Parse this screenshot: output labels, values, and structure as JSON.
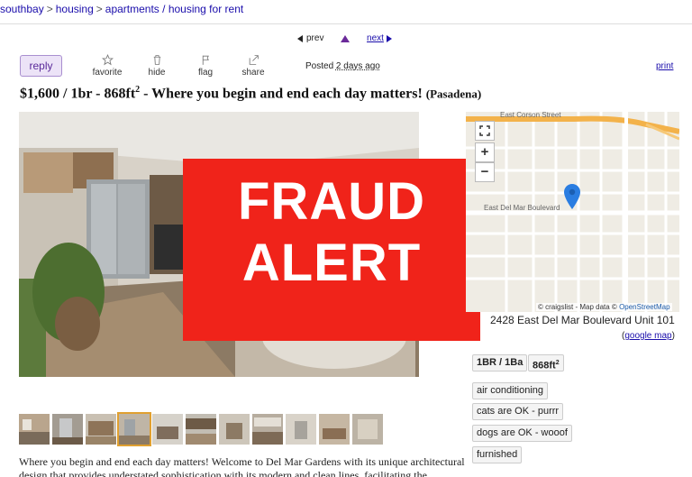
{
  "breadcrumb": {
    "items": [
      "southbay",
      "housing",
      "apartments / housing for rent"
    ],
    "sep": ">"
  },
  "pager": {
    "prev": "prev",
    "next": "next"
  },
  "actions": {
    "reply": "reply",
    "favorite": "favorite",
    "hide": "hide",
    "flag": "flag",
    "share": "share"
  },
  "posted": {
    "prefix": "Posted",
    "when": "2 days ago"
  },
  "print": "print",
  "title": {
    "main": "$1,600 / 1br - 868ft",
    "sup": "2",
    "tail": " - Where you begin and end each day matters!",
    "location": "(Pasadena)"
  },
  "overlay": {
    "line1": "FRAUD",
    "line2": "ALERT"
  },
  "description": "Where you begin and end each day matters! Welcome to Del Mar Gardens with its unique architectural design that provides understated sophistication with its modern and clean lines, facilitating the",
  "map": {
    "street_top": "East Corson Street",
    "street_mid": "East Del Mar Boulevard",
    "zoom_in": "+",
    "zoom_out": "−",
    "attribution": "© craigslist - Map data ©",
    "osm": "OpenStreetMap"
  },
  "address": "2428 East Del Mar Boulevard Unit 101",
  "google_map": {
    "open": "(",
    "link": "google map",
    "close": ")"
  },
  "attrs": {
    "br_ba": "1BR / 1Ba",
    "sqft": "868ft",
    "sqft_sup": "2"
  },
  "amenities": [
    "air conditioning",
    "cats are OK - purrr",
    "dogs are OK - wooof",
    "furnished"
  ],
  "colors": {
    "link": "#1a0dab",
    "fraud": "#f0231a",
    "reply_bg": "#ece3f7",
    "map_pin": "#2a7de1"
  }
}
